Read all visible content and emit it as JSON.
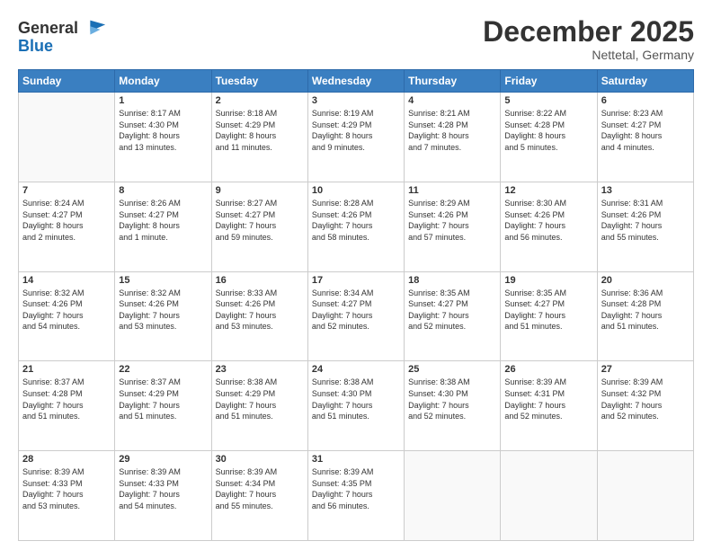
{
  "logo": {
    "text_general": "General",
    "text_blue": "Blue"
  },
  "header": {
    "month": "December 2025",
    "location": "Nettetal, Germany"
  },
  "weekdays": [
    "Sunday",
    "Monday",
    "Tuesday",
    "Wednesday",
    "Thursday",
    "Friday",
    "Saturday"
  ],
  "weeks": [
    [
      {
        "day": "",
        "info": ""
      },
      {
        "day": "1",
        "info": "Sunrise: 8:17 AM\nSunset: 4:30 PM\nDaylight: 8 hours\nand 13 minutes."
      },
      {
        "day": "2",
        "info": "Sunrise: 8:18 AM\nSunset: 4:29 PM\nDaylight: 8 hours\nand 11 minutes."
      },
      {
        "day": "3",
        "info": "Sunrise: 8:19 AM\nSunset: 4:29 PM\nDaylight: 8 hours\nand 9 minutes."
      },
      {
        "day": "4",
        "info": "Sunrise: 8:21 AM\nSunset: 4:28 PM\nDaylight: 8 hours\nand 7 minutes."
      },
      {
        "day": "5",
        "info": "Sunrise: 8:22 AM\nSunset: 4:28 PM\nDaylight: 8 hours\nand 5 minutes."
      },
      {
        "day": "6",
        "info": "Sunrise: 8:23 AM\nSunset: 4:27 PM\nDaylight: 8 hours\nand 4 minutes."
      }
    ],
    [
      {
        "day": "7",
        "info": "Sunrise: 8:24 AM\nSunset: 4:27 PM\nDaylight: 8 hours\nand 2 minutes."
      },
      {
        "day": "8",
        "info": "Sunrise: 8:26 AM\nSunset: 4:27 PM\nDaylight: 8 hours\nand 1 minute."
      },
      {
        "day": "9",
        "info": "Sunrise: 8:27 AM\nSunset: 4:27 PM\nDaylight: 7 hours\nand 59 minutes."
      },
      {
        "day": "10",
        "info": "Sunrise: 8:28 AM\nSunset: 4:26 PM\nDaylight: 7 hours\nand 58 minutes."
      },
      {
        "day": "11",
        "info": "Sunrise: 8:29 AM\nSunset: 4:26 PM\nDaylight: 7 hours\nand 57 minutes."
      },
      {
        "day": "12",
        "info": "Sunrise: 8:30 AM\nSunset: 4:26 PM\nDaylight: 7 hours\nand 56 minutes."
      },
      {
        "day": "13",
        "info": "Sunrise: 8:31 AM\nSunset: 4:26 PM\nDaylight: 7 hours\nand 55 minutes."
      }
    ],
    [
      {
        "day": "14",
        "info": "Sunrise: 8:32 AM\nSunset: 4:26 PM\nDaylight: 7 hours\nand 54 minutes."
      },
      {
        "day": "15",
        "info": "Sunrise: 8:32 AM\nSunset: 4:26 PM\nDaylight: 7 hours\nand 53 minutes."
      },
      {
        "day": "16",
        "info": "Sunrise: 8:33 AM\nSunset: 4:26 PM\nDaylight: 7 hours\nand 53 minutes."
      },
      {
        "day": "17",
        "info": "Sunrise: 8:34 AM\nSunset: 4:27 PM\nDaylight: 7 hours\nand 52 minutes."
      },
      {
        "day": "18",
        "info": "Sunrise: 8:35 AM\nSunset: 4:27 PM\nDaylight: 7 hours\nand 52 minutes."
      },
      {
        "day": "19",
        "info": "Sunrise: 8:35 AM\nSunset: 4:27 PM\nDaylight: 7 hours\nand 51 minutes."
      },
      {
        "day": "20",
        "info": "Sunrise: 8:36 AM\nSunset: 4:28 PM\nDaylight: 7 hours\nand 51 minutes."
      }
    ],
    [
      {
        "day": "21",
        "info": "Sunrise: 8:37 AM\nSunset: 4:28 PM\nDaylight: 7 hours\nand 51 minutes."
      },
      {
        "day": "22",
        "info": "Sunrise: 8:37 AM\nSunset: 4:29 PM\nDaylight: 7 hours\nand 51 minutes."
      },
      {
        "day": "23",
        "info": "Sunrise: 8:38 AM\nSunset: 4:29 PM\nDaylight: 7 hours\nand 51 minutes."
      },
      {
        "day": "24",
        "info": "Sunrise: 8:38 AM\nSunset: 4:30 PM\nDaylight: 7 hours\nand 51 minutes."
      },
      {
        "day": "25",
        "info": "Sunrise: 8:38 AM\nSunset: 4:30 PM\nDaylight: 7 hours\nand 52 minutes."
      },
      {
        "day": "26",
        "info": "Sunrise: 8:39 AM\nSunset: 4:31 PM\nDaylight: 7 hours\nand 52 minutes."
      },
      {
        "day": "27",
        "info": "Sunrise: 8:39 AM\nSunset: 4:32 PM\nDaylight: 7 hours\nand 52 minutes."
      }
    ],
    [
      {
        "day": "28",
        "info": "Sunrise: 8:39 AM\nSunset: 4:33 PM\nDaylight: 7 hours\nand 53 minutes."
      },
      {
        "day": "29",
        "info": "Sunrise: 8:39 AM\nSunset: 4:33 PM\nDaylight: 7 hours\nand 54 minutes."
      },
      {
        "day": "30",
        "info": "Sunrise: 8:39 AM\nSunset: 4:34 PM\nDaylight: 7 hours\nand 55 minutes."
      },
      {
        "day": "31",
        "info": "Sunrise: 8:39 AM\nSunset: 4:35 PM\nDaylight: 7 hours\nand 56 minutes."
      },
      {
        "day": "",
        "info": ""
      },
      {
        "day": "",
        "info": ""
      },
      {
        "day": "",
        "info": ""
      }
    ]
  ]
}
